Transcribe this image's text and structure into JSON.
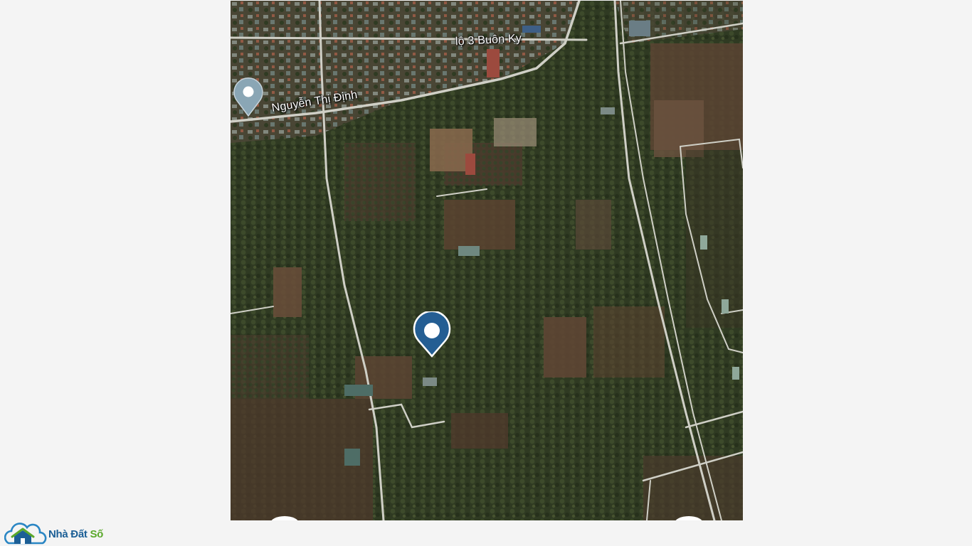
{
  "map": {
    "road_labels": {
      "buon_ky": "lộ 3 Buôn Ky",
      "nguyen_thi_dinh": "Nguyễn Thị Định"
    },
    "markers": {
      "secondary_color": "#8aa6b5",
      "primary_color": "#245e93"
    }
  },
  "logo": {
    "name_part1": "Nhà Đất ",
    "name_part2": "Số",
    "colors": {
      "primary": "#1c5f96",
      "accent": "#5aa82a"
    }
  }
}
